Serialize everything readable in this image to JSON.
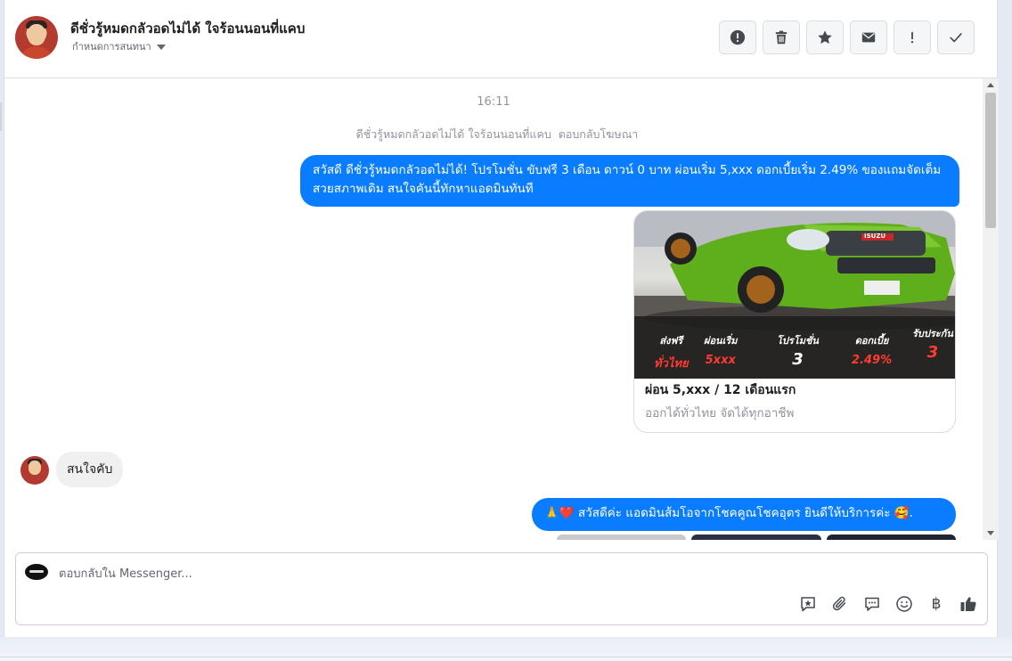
{
  "header": {
    "contact_name": "ดีชั่วรู้หมดกลัวอดไม่ได้ ใจร้อนนอนที่แคบ",
    "label_menu": "กำหนดการสนทนา"
  },
  "actions": [
    {
      "icon": "alert-circle-icon"
    },
    {
      "icon": "trash-icon"
    },
    {
      "icon": "star-icon"
    },
    {
      "icon": "envelope-icon"
    },
    {
      "icon": "exclamation-icon"
    },
    {
      "icon": "check-icon"
    }
  ],
  "thread": {
    "timestamp": "16:11",
    "ad_reply_note_name": "ดีชั่วรู้หมดกลัวอดไม่ได้ ใจร้อนนอนที่แคบ",
    "ad_reply_note_action": "ตอบกลับโฆษณา",
    "message_1": "สวัสดี ดีชั่วรู้หมดกลัวอดไม่ได้! โปรโมชั่น ขับฟรี 3 เดือน ดาวน์ 0 บาท ผ่อนเริ่ม 5,xxx  ดอกเบี้ยเริ่ม 2.49% ของแถมจัดเต็ม สวยสภาพเดิม สนใจคันนี้ทักหาแอดมินทันที",
    "card": {
      "title": "ผ่อน 5,xxx / 12 เดือนแรก",
      "description": "ออกได้ทั่วไทย จัดได้ทุกอาชีพ",
      "brand_badge": "ISUZU",
      "promo": [
        {
          "label": "ส่งฟรี",
          "value": "ทั่วไทย"
        },
        {
          "label": "ผ่อนเริ่ม",
          "value": "5xxx"
        },
        {
          "label": "โปรโมชั่น",
          "value": "3"
        },
        {
          "label": "ดอกเบี้ย",
          "value": "2.49%"
        },
        {
          "label": "รับประกัน",
          "value": "3"
        }
      ]
    },
    "incoming_message": "สนใจคับ",
    "message_2": "🙏❤️ สวัสดีค่ะ แอดมินส้มโอจากโชคคูณโชคอุตร ยินดีให้บริการค่ะ 🥰."
  },
  "composer": {
    "placeholder": "ตอบกลับใน Messenger...",
    "tools": [
      "saved-reply-icon",
      "attachment-icon",
      "chat-bubble-icon",
      "emoji-icon",
      "baht-icon",
      "thumbs-up-icon"
    ],
    "baht_symbol": "฿"
  },
  "colors": {
    "outgoing_bubble": "#0a7cff",
    "incoming_bubble": "#f1f0f0",
    "promo_red": "#ff3b30"
  }
}
